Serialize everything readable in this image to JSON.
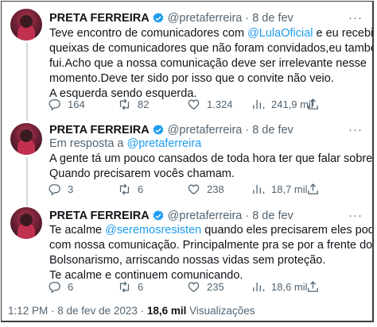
{
  "tweets": [
    {
      "name": "PRETA FERREIRA",
      "handle": "@pretaferreira",
      "dot": "·",
      "date": "8 de fev",
      "more": "···",
      "lines": [
        [
          "Teve encontro de comunicadores com ",
          "@LulaOficial",
          " e eu recebi várias"
        ],
        [
          "queixas de comunicadores que não foram convidados,eu também não"
        ],
        [
          "fui.Acho que a nossa comunicação deve ser irrelevante nesse"
        ],
        [
          "momento.Deve ter sido por isso que o convite não veio."
        ],
        [
          "A esquerda sendo esquerda."
        ]
      ],
      "stats": {
        "replies": "164",
        "retweets": "82",
        "likes": "1.324",
        "views": "241,9 mil"
      }
    },
    {
      "name": "PRETA FERREIRA",
      "handle": "@pretaferreira",
      "dot": "·",
      "date": "8 de fev",
      "more": "···",
      "reply_prefix": "Em resposta a ",
      "reply_handle": "@pretaferreira",
      "lines": [
        [
          "A gente tá um pouco cansados de toda hora ter que falar sobre isso."
        ],
        [
          "Quando precisarem vocês chamam."
        ]
      ],
      "stats": {
        "replies": "3",
        "retweets": "6",
        "likes": "238",
        "views": "18,7 mil"
      }
    },
    {
      "name": "PRETA FERREIRA",
      "handle": "@pretaferreira",
      "dot": "·",
      "date": "8 de fev",
      "more": "···",
      "lines": [
        [
          "Te acalme ",
          "@seremosresisten",
          " quando eles precisarem eles podem contar"
        ],
        [
          "com nossa comunicação. Principalmente pra se por a frente do"
        ],
        [
          "Bolsonarismo, arriscando nossas vidas sem proteção."
        ],
        [
          "Te acalme e continuem comunicando."
        ]
      ],
      "stats": {
        "replies": "6",
        "retweets": "6",
        "likes": "235",
        "views": "18,6 mil"
      }
    }
  ],
  "footer": {
    "time": "1:12 PM",
    "sep": " · ",
    "date": "8 de fev de 2023",
    "sep2": " · ",
    "views_count": "18,6 mil",
    "views_label": " Visualizações"
  },
  "colors": {
    "link": "#1d9bf0",
    "muted": "#536471",
    "verified": "#1d9bf0"
  },
  "icons": [
    "reply-icon",
    "retweet-icon",
    "like-icon",
    "views-icon",
    "share-icon",
    "verified-badge-icon",
    "more-icon"
  ]
}
